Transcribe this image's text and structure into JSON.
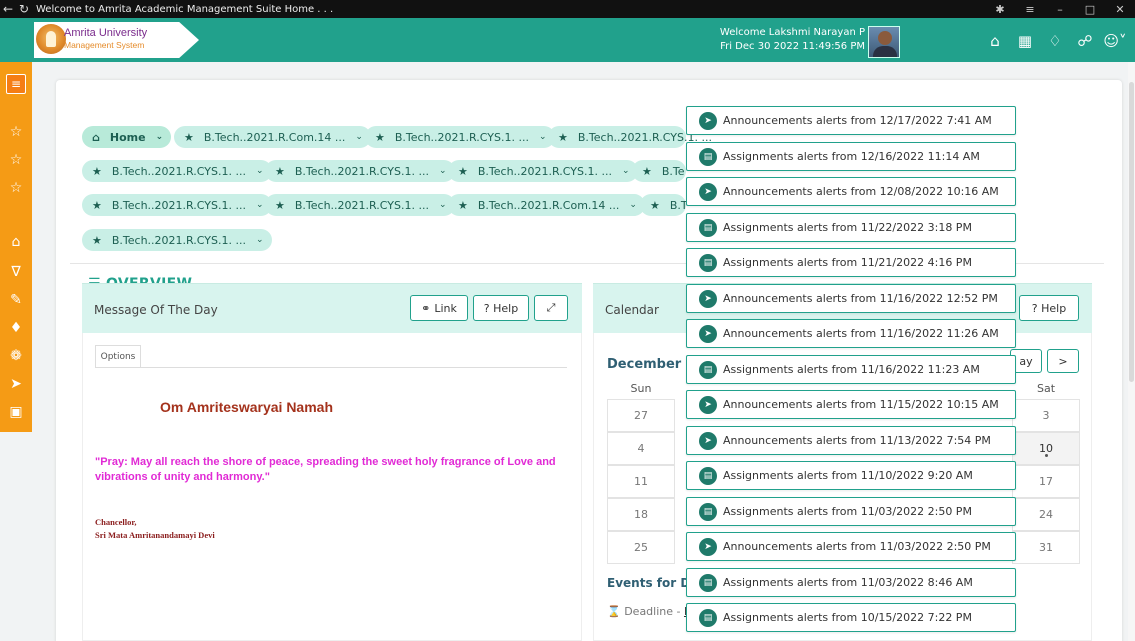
{
  "window": {
    "title": "Welcome to Amrita Academic Management Suite Home . . .",
    "back_icon": "arrow-left-icon",
    "reload_icon": "reload-icon"
  },
  "header": {
    "logo_line1": "Amrita University",
    "logo_line2": "Management System",
    "welcome": "Welcome Lakshmi Narayan P",
    "datetime": "Fri Dec 30 2022 11:49:56 PM"
  },
  "chips": {
    "home": "Home",
    "c1": "B.Tech..2021.R.Com.14 ...",
    "c2": "B.Tech..2021.R.CYS.1. ...",
    "c3": "B.Tech..2021.R.CYS.1. ...",
    "c4": "B.Tech..2021.R.CYS.1. ...",
    "c5": "B.Tech..2021.R.CYS.1. ...",
    "c6": "B.Tech..2021.R.CYS.1. ...",
    "c7": "B.Te",
    "c8": "B.Tech..2021.R.CYS.1. ...",
    "c9": "B.Tech..2021.R.CYS.1. ...",
    "c10": "B.Tech..2021.R.Com.14 ...",
    "c11": "B.T",
    "c12": "B.Tech..2021.R.CYS.1. ..."
  },
  "overview": {
    "label": "OVERVIEW"
  },
  "motd": {
    "title": "Message Of The Day",
    "link_label": "Link",
    "help_label": "? Help",
    "options_tab": "Options",
    "om": "Om Amriteswaryai Namah",
    "quote": "\"Pray: May all reach the shore of peace, spreading the sweet holy fragrance of Love and vibrations of unity and harmony.\"",
    "author_line1": "Chancellor,",
    "author_line2": "Sri Mata Amritanandamayi Devi"
  },
  "calendar": {
    "title": "Calendar",
    "help_label": "? Help",
    "month": "December 2",
    "today_btn": "ay",
    "next_btn": ">",
    "dow_sun": "Sun",
    "dow_sat": "Sat",
    "sun_days": [
      "27",
      "4",
      "11",
      "18",
      "25"
    ],
    "sat_days": [
      "3",
      "10",
      "17",
      "24",
      "31"
    ],
    "events_title": "Events for De",
    "deadline_label": "Deadline - ",
    "deadline_link": "Dr"
  },
  "alerts": [
    {
      "type": "announcement",
      "text": "Announcements alerts from 12/17/2022 7:41 AM"
    },
    {
      "type": "assignment",
      "text": "Assignments alerts from 12/16/2022 11:14 AM"
    },
    {
      "type": "announcement",
      "text": "Announcements alerts from 12/08/2022 10:16 AM"
    },
    {
      "type": "assignment",
      "text": "Assignments alerts from 11/22/2022 3:18 PM"
    },
    {
      "type": "assignment",
      "text": "Assignments alerts from 11/21/2022 4:16 PM"
    },
    {
      "type": "announcement",
      "text": "Announcements alerts from 11/16/2022 12:52 PM"
    },
    {
      "type": "announcement",
      "text": "Announcements alerts from 11/16/2022 11:26 AM"
    },
    {
      "type": "assignment",
      "text": "Assignments alerts from 11/16/2022 11:23 AM"
    },
    {
      "type": "announcement",
      "text": "Announcements alerts from 11/15/2022 10:15 AM"
    },
    {
      "type": "announcement",
      "text": "Announcements alerts from 11/13/2022 7:54 PM"
    },
    {
      "type": "assignment",
      "text": "Assignments alerts from 11/10/2022 9:20 AM"
    },
    {
      "type": "assignment",
      "text": "Assignments alerts from 11/03/2022 2:50 PM"
    },
    {
      "type": "announcement",
      "text": "Announcements alerts from 11/03/2022 2:50 PM"
    },
    {
      "type": "assignment",
      "text": "Assignments alerts from 11/03/2022 8:46 AM"
    },
    {
      "type": "assignment",
      "text": "Assignments alerts from 10/15/2022 7:22 PM"
    }
  ],
  "colors": {
    "header": "#21a18c",
    "sidebar": "#f59b15",
    "chip": "#c9efe6",
    "quote": "#e12ad5",
    "om": "#a4321c"
  }
}
